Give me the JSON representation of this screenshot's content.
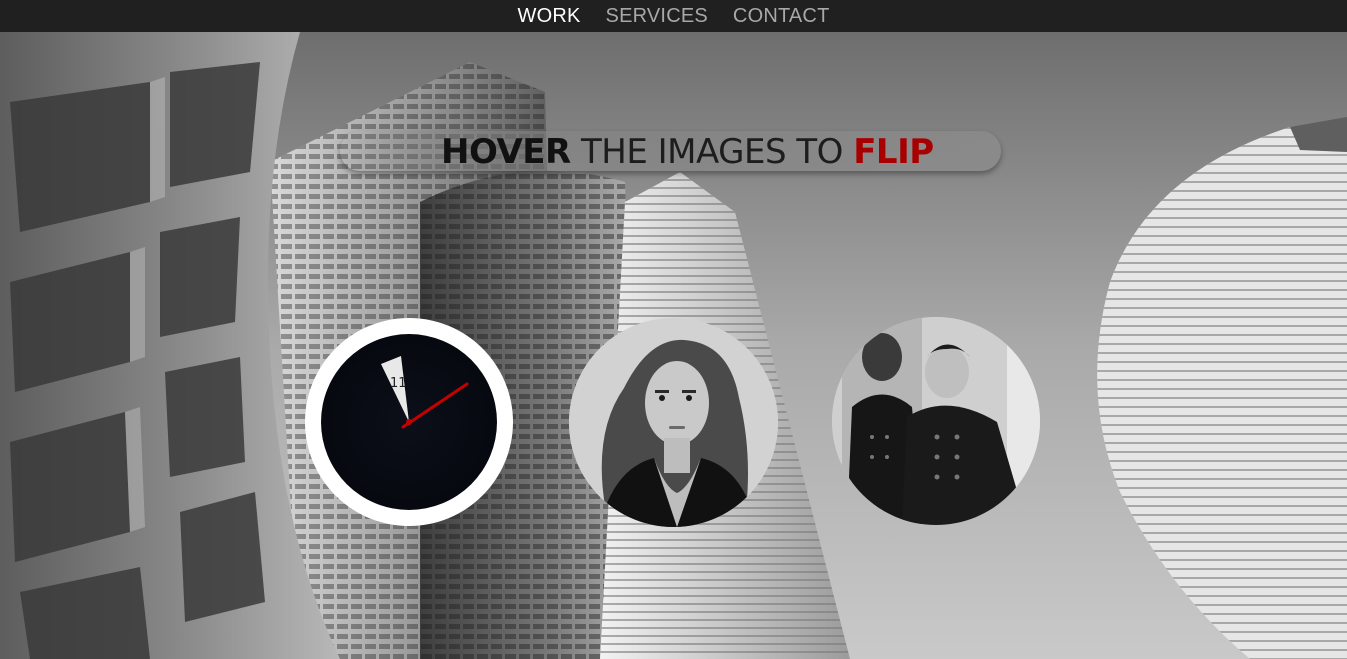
{
  "nav": {
    "items": [
      {
        "label": "WORK",
        "active": true
      },
      {
        "label": "SERVICES",
        "active": false
      },
      {
        "label": "CONTACT",
        "active": false
      }
    ]
  },
  "headline": {
    "part1": "HOVER",
    "part2": " THE IMAGES TO ",
    "part3": "FLIP"
  },
  "clock": {
    "number": "11"
  },
  "colors": {
    "nav_bg": "#202020",
    "nav_active": "#ffffff",
    "nav_inactive": "#a8a8a8",
    "accent_red": "#a80000",
    "clock_hand": "#c40000"
  }
}
